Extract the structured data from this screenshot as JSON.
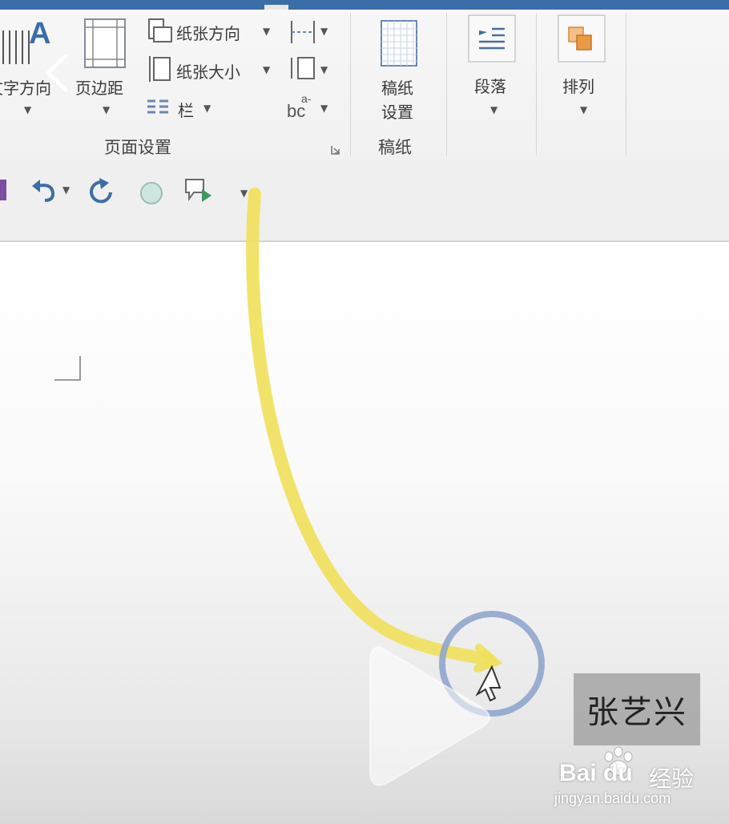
{
  "ribbon": {
    "text_direction_label": "文字方向",
    "margins_label": "页边距",
    "orientation_label": "纸张方向",
    "size_label": "纸张大小",
    "columns_label": "栏",
    "page_setup_group": "页面设置",
    "draft_paper_label_1": "稿纸",
    "draft_paper_label_2": "设置",
    "draft_paper_group": "稿纸",
    "paragraph_label": "段落",
    "arrange_label": "排列"
  },
  "overlay": {
    "name_tag": "张艺兴",
    "watermark_brand": "Bai du",
    "watermark_jingyan": "经验",
    "watermark_url": "jingyan.baidu.com"
  },
  "colors": {
    "accent_blue": "#3b6ea8",
    "annotation_yellow": "#efe05a",
    "cursor_circle": "#8fa6cc"
  }
}
